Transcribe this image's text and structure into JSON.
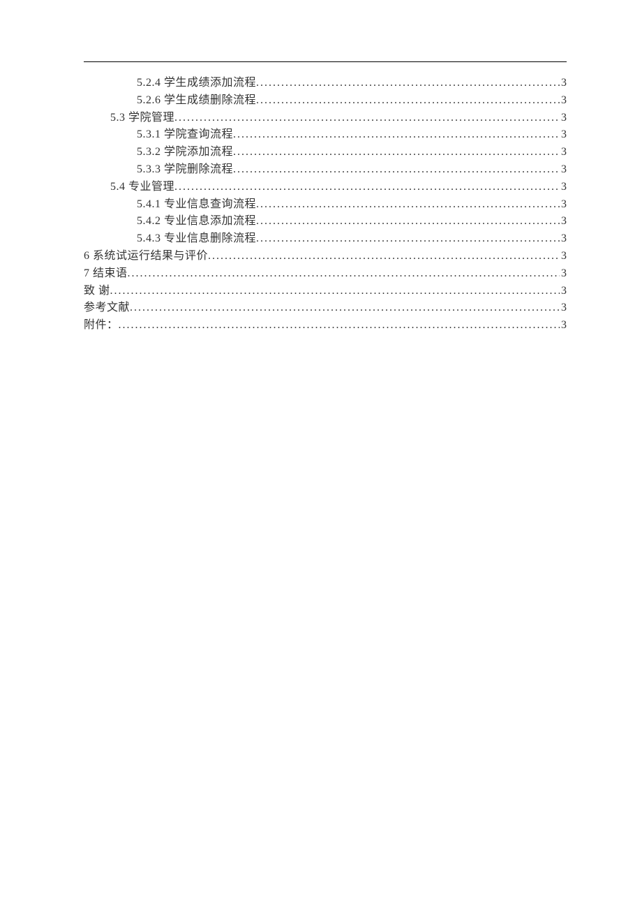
{
  "toc": [
    {
      "indent": 2,
      "label": "5.2.4 学生成绩添加流程",
      "page": "3"
    },
    {
      "indent": 2,
      "label": "5.2.6 学生成绩删除流程",
      "page": "3"
    },
    {
      "indent": 1,
      "label": "5.3 学院管理",
      "page": "3"
    },
    {
      "indent": 2,
      "label": "5.3.1 学院查询流程",
      "page": "3"
    },
    {
      "indent": 2,
      "label": "5.3.2 学院添加流程",
      "page": "3"
    },
    {
      "indent": 2,
      "label": "5.3.3 学院删除流程",
      "page": "3"
    },
    {
      "indent": 1,
      "label": "5.4 专业管理",
      "page": "3"
    },
    {
      "indent": 2,
      "label": "5.4.1 专业信息查询流程",
      "page": "3"
    },
    {
      "indent": 2,
      "label": "5.4.2 专业信息添加流程",
      "page": "3"
    },
    {
      "indent": 2,
      "label": "5.4.3 专业信息删除流程",
      "page": "3"
    },
    {
      "indent": 0,
      "label": "6 系统试运行结果与评价",
      "page": "3"
    },
    {
      "indent": 0,
      "label": "7 结束语",
      "page": "3"
    },
    {
      "indent": 0,
      "label": "致 谢",
      "page": "3"
    },
    {
      "indent": 0,
      "label": "参考文献",
      "page": "3"
    },
    {
      "indent": 0,
      "label": "附件：",
      "page": "3"
    }
  ]
}
